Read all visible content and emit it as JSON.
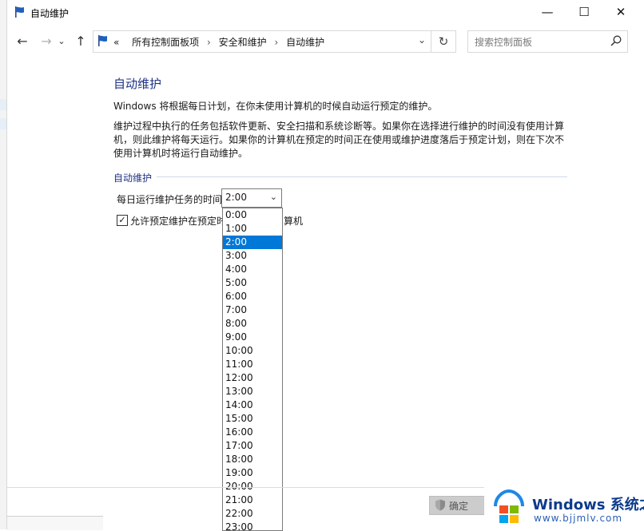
{
  "window": {
    "title": "自动维护",
    "minimize_glyph": "—",
    "maximize_glyph": "☐",
    "close_glyph": "✕"
  },
  "nav": {
    "back_glyph": "←",
    "forward_glyph": "→",
    "recent_glyph": "⌄",
    "up_glyph": "↑",
    "address_prefix": "«",
    "breadcrumbs": [
      "所有控制面板项",
      "安全和维护",
      "自动维护"
    ],
    "breadcrumb_separator": "›",
    "address_dropdown_glyph": "⌄",
    "refresh_glyph": "↻",
    "search_placeholder": "搜索控制面板"
  },
  "main": {
    "title": "自动维护",
    "lead": "Windows 将根据每日计划，在你未使用计算机的时候自动运行预定的维护。",
    "description": "维护过程中执行的任务包括软件更新、安全扫描和系统诊断等。如果你在选择进行维护的时间没有使用计算机，则此维护将每天运行。如果你的计算机在预定的时间正在使用或维护进度落后于预定计划，则在下次不使用计算机时将运行自动维护。",
    "section_heading": "自动维护",
    "time_label": "每日运行维护任务的时间",
    "time_value": "2:00",
    "time_dropdown_glyph": "⌄",
    "wake_checkbox_checked": true,
    "wake_checkbox_glyph": "✓",
    "wake_label_visible_start": "允许预定维护在预定时",
    "wake_label_visible_end": "算机"
  },
  "time_options": [
    "0:00",
    "1:00",
    "2:00",
    "3:00",
    "4:00",
    "5:00",
    "6:00",
    "7:00",
    "8:00",
    "9:00",
    "10:00",
    "11:00",
    "12:00",
    "13:00",
    "14:00",
    "15:00",
    "16:00",
    "17:00",
    "18:00",
    "19:00",
    "20:00",
    "21:00",
    "22:00",
    "23:00"
  ],
  "selected_time_index": 2,
  "footer": {
    "ok_label": "确定"
  },
  "watermark": {
    "brand": "Windows 系统之家",
    "url": "www.bjjmlv.com"
  },
  "colors": {
    "accent_title": "#1e3287",
    "selection": "#0078d7"
  }
}
